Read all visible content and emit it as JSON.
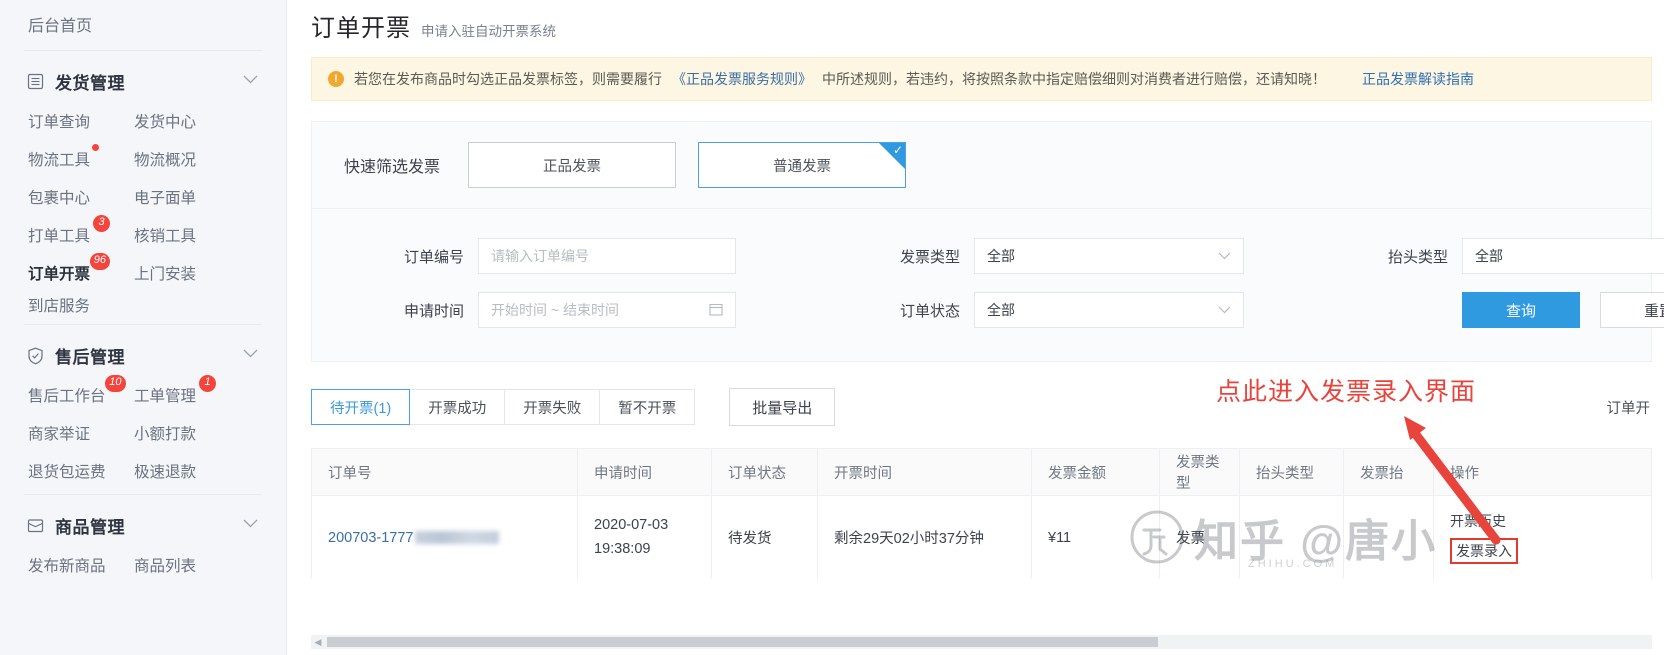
{
  "sidebar": {
    "home_label": "后台首页",
    "groups": [
      {
        "title": "发货管理",
        "icon": "list-icon",
        "chevron": "chevron-down-icon",
        "links": [
          {
            "label": "订单查询",
            "badge": "",
            "badge_type": "",
            "active": false
          },
          {
            "label": "发货中心",
            "badge": "",
            "badge_type": "",
            "active": false
          },
          {
            "label": "物流工具",
            "badge": "",
            "badge_type": "dot",
            "active": false
          },
          {
            "label": "物流概况",
            "badge": "",
            "badge_type": "",
            "active": false
          },
          {
            "label": "包裹中心",
            "badge": "",
            "badge_type": "",
            "active": false
          },
          {
            "label": "电子面单",
            "badge": "",
            "badge_type": "",
            "active": false
          },
          {
            "label": "打单工具",
            "badge": "3",
            "badge_type": "num",
            "active": false
          },
          {
            "label": "核销工具",
            "badge": "",
            "badge_type": "",
            "active": false
          },
          {
            "label": "订单开票",
            "badge": "96",
            "badge_type": "num",
            "active": true
          },
          {
            "label": "上门安装",
            "badge": "",
            "badge_type": "",
            "active": false
          }
        ],
        "single": "到店服务"
      },
      {
        "title": "售后管理",
        "icon": "shield-icon",
        "chevron": "chevron-down-icon",
        "links": [
          {
            "label": "售后工作台",
            "badge": "10",
            "badge_type": "num",
            "active": false
          },
          {
            "label": "工单管理",
            "badge": "1",
            "badge_type": "num",
            "active": false
          },
          {
            "label": "商家举证",
            "badge": "",
            "badge_type": "",
            "active": false
          },
          {
            "label": "小额打款",
            "badge": "",
            "badge_type": "",
            "active": false
          },
          {
            "label": "退货包运费",
            "badge": "",
            "badge_type": "",
            "active": false
          },
          {
            "label": "极速退款",
            "badge": "",
            "badge_type": "",
            "active": false
          }
        ],
        "single": ""
      },
      {
        "title": "商品管理",
        "icon": "box-icon",
        "chevron": "chevron-down-icon",
        "links": [
          {
            "label": "发布新商品",
            "badge": "",
            "badge_type": "",
            "active": false
          },
          {
            "label": "商品列表",
            "badge": "",
            "badge_type": "",
            "active": false
          }
        ],
        "single": ""
      }
    ]
  },
  "header": {
    "title": "订单开票",
    "subtitle": "申请入驻自动开票系统"
  },
  "banner": {
    "icon": "warning-icon",
    "text_before": "若您在发布商品时勾选正品发票标签，则需要履行",
    "rule_link": "《正品发票服务规则》",
    "text_after": "中所述规则，若违约，将按照条款中指定赔偿细则对消费者进行赔偿，还请知晓！",
    "guide_link": "正品发票解读指南"
  },
  "quick_filter": {
    "label": "快速筛选发票",
    "chips": [
      {
        "label": "正品发票",
        "selected": false
      },
      {
        "label": "普通发票",
        "selected": true
      }
    ],
    "check_icon": "check-icon"
  },
  "form": {
    "order_no": {
      "label": "订单编号",
      "placeholder": "请输入订单编号",
      "value": ""
    },
    "invoice_type": {
      "label": "发票类型",
      "value": "全部",
      "icon": "chevron-down-icon"
    },
    "title_type": {
      "label": "抬头类型",
      "value": "全部",
      "icon": "chevron-down-icon"
    },
    "apply_time": {
      "label": "申请时间",
      "placeholder": "开始时间 ~ 结束时间",
      "icon": "calendar-icon"
    },
    "order_status": {
      "label": "订单状态",
      "value": "全部",
      "icon": "chevron-down-icon"
    },
    "search_button": "查询",
    "reset_button": "重置"
  },
  "tabs": [
    {
      "label": "待开票(1)",
      "active": true
    },
    {
      "label": "开票成功",
      "active": false
    },
    {
      "label": "开票失败",
      "active": false
    },
    {
      "label": "暂不开票",
      "active": false
    }
  ],
  "export_button": "批量导出",
  "right_link": "订单开",
  "table": {
    "columns": [
      "订单号",
      "申请时间",
      "订单状态",
      "开票时间",
      "发票金额",
      "发票类型",
      "抬头类型",
      "发票抬",
      "操作"
    ],
    "rows": [
      {
        "order_no": "200703-1777",
        "apply_time_line1": "2020-07-03",
        "apply_time_line2": "19:38:09",
        "order_status": "待发货",
        "invoice_time": "剩余29天02小时37分钟",
        "amount": "¥11",
        "invoice_type": "发票",
        "title_type": "",
        "invoice_title": "",
        "ops": [
          {
            "label": "开票历史",
            "highlight": false
          },
          {
            "label": "发票录入",
            "highlight": true
          }
        ]
      }
    ]
  },
  "annotation": {
    "text": "点此进入发票录入界面",
    "arrow": "arrow-icon",
    "color": "#e8443b"
  },
  "watermark": {
    "text": "知乎 @唐小",
    "subtext": "ZHIHU.COM"
  },
  "scrollbar": {
    "left_arrow": "chevron-left-icon",
    "right_arrow": "chevron-right-icon"
  }
}
